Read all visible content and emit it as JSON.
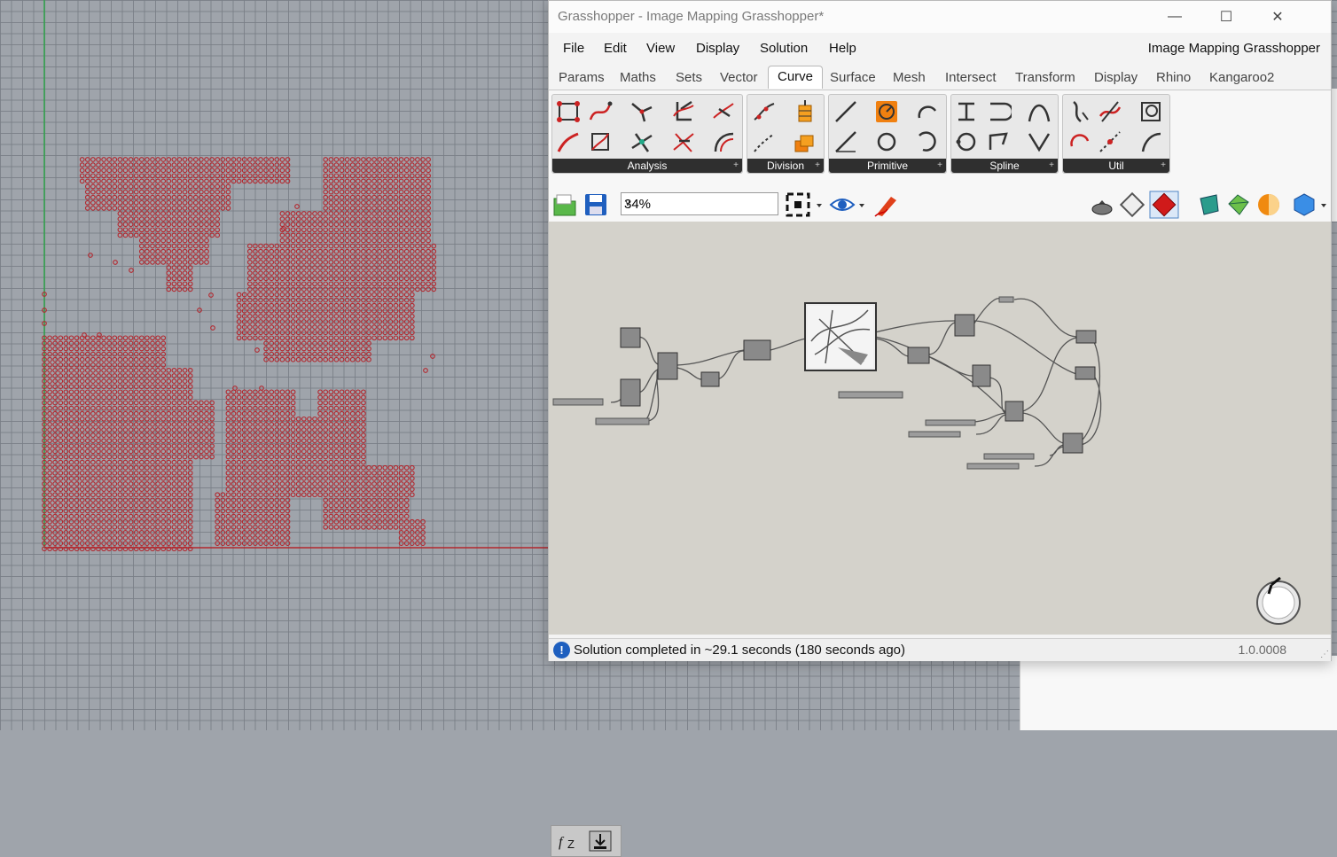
{
  "window": {
    "title": "Grasshopper - Image Mapping Grasshopper*",
    "controls": {
      "minimize": "—",
      "maximize": "☐",
      "close": "✕"
    }
  },
  "menu": {
    "items": [
      "File",
      "Edit",
      "View",
      "Display",
      "Solution",
      "Help"
    ],
    "document_name": "Image Mapping Grasshopper"
  },
  "tabs": {
    "items": [
      "Params",
      "Maths",
      "Sets",
      "Vector",
      "Curve",
      "Surface",
      "Mesh",
      "Intersect",
      "Transform",
      "Display",
      "Rhino",
      "Kangaroo2"
    ],
    "active": "Curve"
  },
  "ribbon": {
    "panels": [
      "Analysis",
      "Division",
      "Primitive",
      "Spline",
      "Util"
    ],
    "expand_glyph": "+"
  },
  "toolbar": {
    "zoom_value": "34%",
    "icons": [
      "open-file-icon",
      "save-file-icon",
      "zoom-extents-icon",
      "preview-eye-icon",
      "sketch-pen-icon",
      "preview-wire-icon",
      "preview-shaded-icon",
      "preview-selected-icon",
      "bake-icon",
      "mesh-settings-icon",
      "material-icon",
      "display-mode-icon"
    ]
  },
  "status": {
    "icon": "!",
    "text": "Solution completed in ~29.1 seconds (180 seconds ago)",
    "version": "1.0.0008"
  },
  "colors": {
    "point_red": "#b3262d",
    "axis_green": "#2fa34a",
    "canvas_bg": "#d4d2cb",
    "viewport_bg": "#9fa4ab"
  }
}
